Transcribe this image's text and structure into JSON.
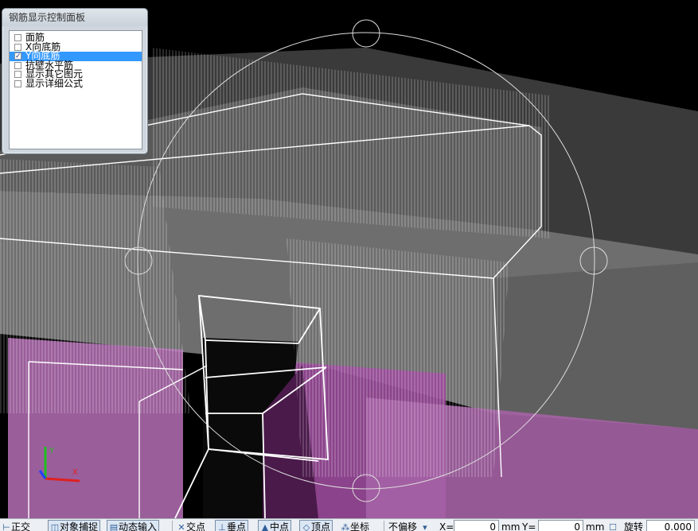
{
  "panel": {
    "title": "钢筋显示控制面板",
    "options": [
      {
        "label": "面筋",
        "checked": false,
        "selected": false
      },
      {
        "label": "X向底筋",
        "checked": false,
        "selected": false
      },
      {
        "label": "Y向底筋",
        "checked": true,
        "selected": true
      },
      {
        "label": "抗壁水平筋",
        "checked": false,
        "selected": false
      },
      {
        "label": "显示其它图元",
        "checked": false,
        "selected": false
      },
      {
        "label": "显示详细公式",
        "checked": false,
        "selected": false
      }
    ]
  },
  "axes": {
    "x": "X",
    "y": "Y",
    "x_color": "#e02020",
    "y_color": "#20c020",
    "z_color": "#2040ff"
  },
  "toolbar": {
    "ortho": "正交",
    "osnap": "对象捕捉",
    "dyn_input": "动态输入",
    "intersection": "交点",
    "perpendicular": "垂点",
    "midpoint": "中点",
    "vertex": "顶点",
    "coords": "坐标",
    "offset_mode": "不偏移",
    "x_label": "X=",
    "x_value": "0",
    "mm1": "mm",
    "y_label": "Y=",
    "y_value": "0",
    "mm2": "mm",
    "rotate": "旋转",
    "rotate_value": "0.000"
  },
  "colors": {
    "pink": "#c87ac8",
    "wire": "#ffffff",
    "panel_sel": "#3399ff"
  }
}
